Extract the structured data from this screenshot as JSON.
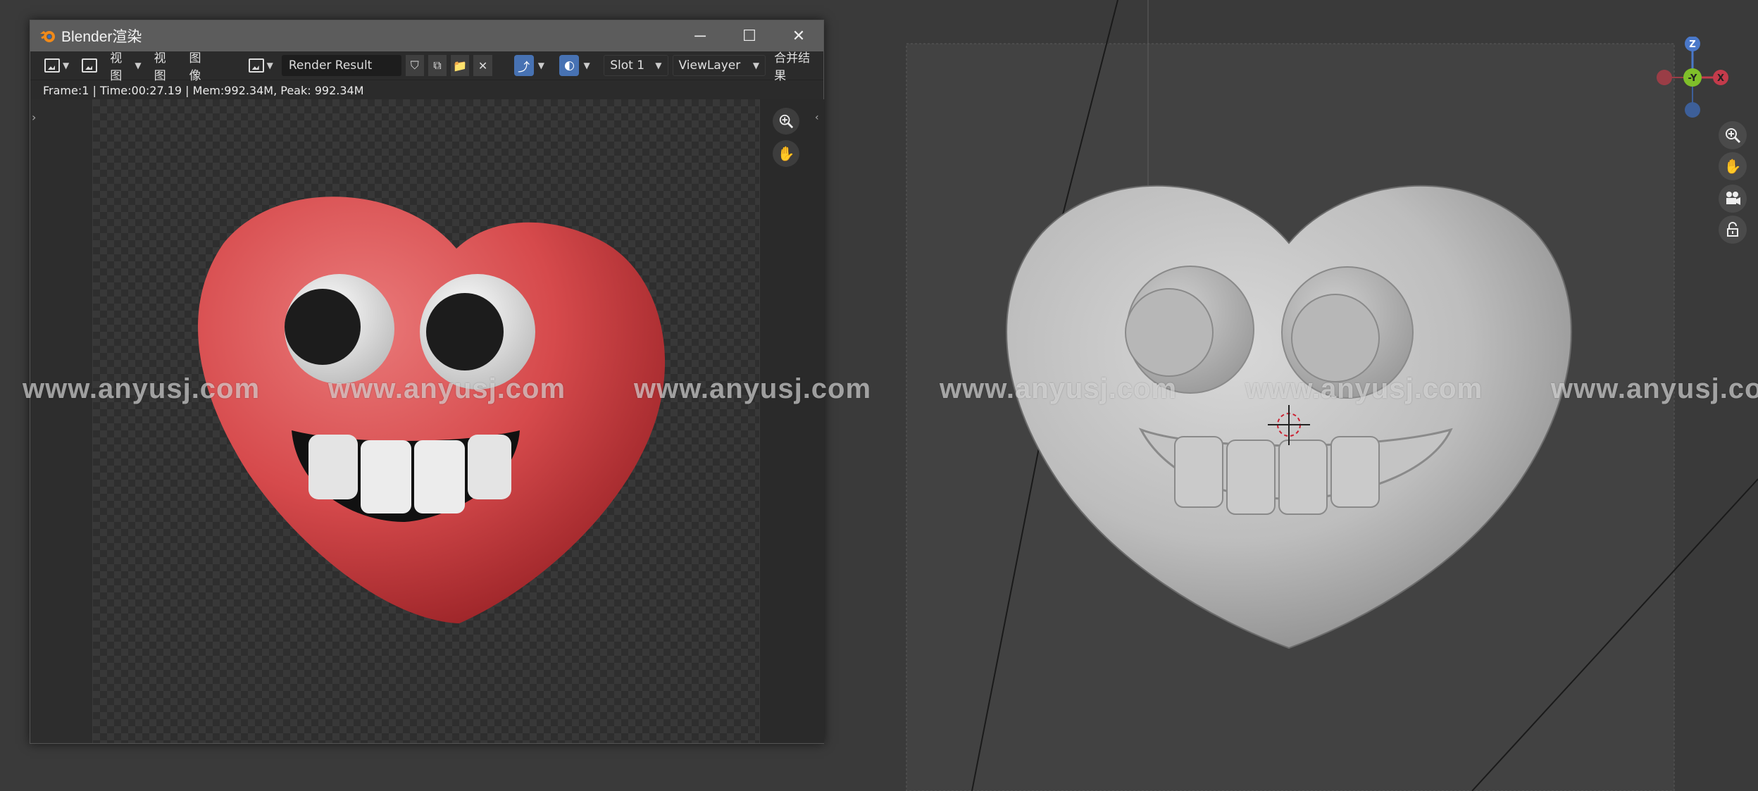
{
  "viewport": {
    "gizmo": {
      "z_label": "Z",
      "y_label": "-Y",
      "x_label": "X"
    },
    "nav_icons": [
      "zoom-icon",
      "hand-pan-icon",
      "camera-icon",
      "lock-icon"
    ]
  },
  "render_window": {
    "title": "Blender渲染",
    "toolbar": {
      "view_menu": "视图",
      "view_menu2": "视图",
      "image_menu": "图像",
      "image_name": "Render Result",
      "slot": "Slot 1",
      "layer": "ViewLayer",
      "composite": "合并结果"
    },
    "status": "Frame:1 | Time:00:27.19 | Mem:992.34M, Peak: 992.34M"
  },
  "watermark_text": "www.anyusj.com",
  "colors": {
    "accent_blue": "#4772b3",
    "heart_red": "#d64a4c",
    "clay_grey": "#cfcfcf"
  }
}
